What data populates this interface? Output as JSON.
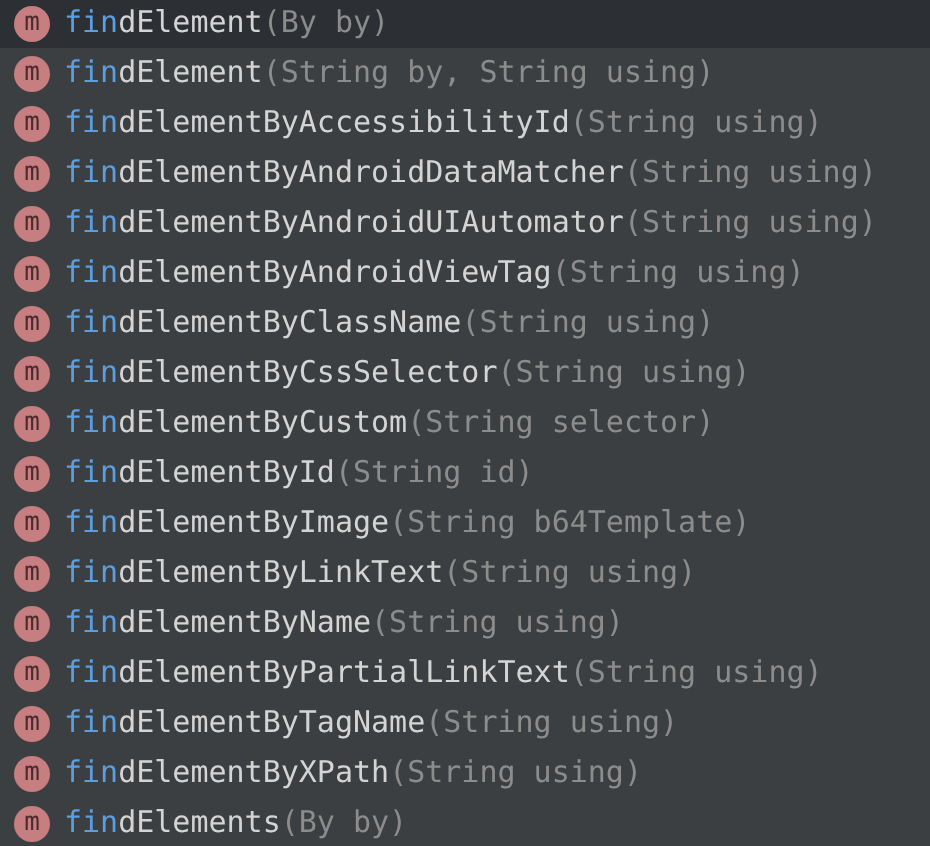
{
  "completions": [
    {
      "icon": "m",
      "match": "fin",
      "name": "dElement",
      "params": "(By by)",
      "selected": true
    },
    {
      "icon": "m",
      "match": "fin",
      "name": "dElement",
      "params": "(String by, String using)",
      "selected": false
    },
    {
      "icon": "m",
      "match": "fin",
      "name": "dElementByAccessibilityId",
      "params": "(String using)",
      "selected": false
    },
    {
      "icon": "m",
      "match": "fin",
      "name": "dElementByAndroidDataMatcher",
      "params": "(String using)",
      "selected": false
    },
    {
      "icon": "m",
      "match": "fin",
      "name": "dElementByAndroidUIAutomator",
      "params": "(String using)",
      "selected": false
    },
    {
      "icon": "m",
      "match": "fin",
      "name": "dElementByAndroidViewTag",
      "params": "(String using)",
      "selected": false
    },
    {
      "icon": "m",
      "match": "fin",
      "name": "dElementByClassName",
      "params": "(String using)",
      "selected": false
    },
    {
      "icon": "m",
      "match": "fin",
      "name": "dElementByCssSelector",
      "params": "(String using)",
      "selected": false
    },
    {
      "icon": "m",
      "match": "fin",
      "name": "dElementByCustom",
      "params": "(String selector)",
      "selected": false
    },
    {
      "icon": "m",
      "match": "fin",
      "name": "dElementById",
      "params": "(String id)",
      "selected": false
    },
    {
      "icon": "m",
      "match": "fin",
      "name": "dElementByImage",
      "params": "(String b64Template)",
      "selected": false
    },
    {
      "icon": "m",
      "match": "fin",
      "name": "dElementByLinkText",
      "params": "(String using)",
      "selected": false
    },
    {
      "icon": "m",
      "match": "fin",
      "name": "dElementByName",
      "params": "(String using)",
      "selected": false
    },
    {
      "icon": "m",
      "match": "fin",
      "name": "dElementByPartialLinkText",
      "params": "(String using)",
      "selected": false
    },
    {
      "icon": "m",
      "match": "fin",
      "name": "dElementByTagName",
      "params": "(String using)",
      "selected": false
    },
    {
      "icon": "m",
      "match": "fin",
      "name": "dElementByXPath",
      "params": "(String using)",
      "selected": false
    },
    {
      "icon": "m",
      "match": "fin",
      "name": "dElements",
      "params": "(By by)",
      "selected": false
    }
  ]
}
